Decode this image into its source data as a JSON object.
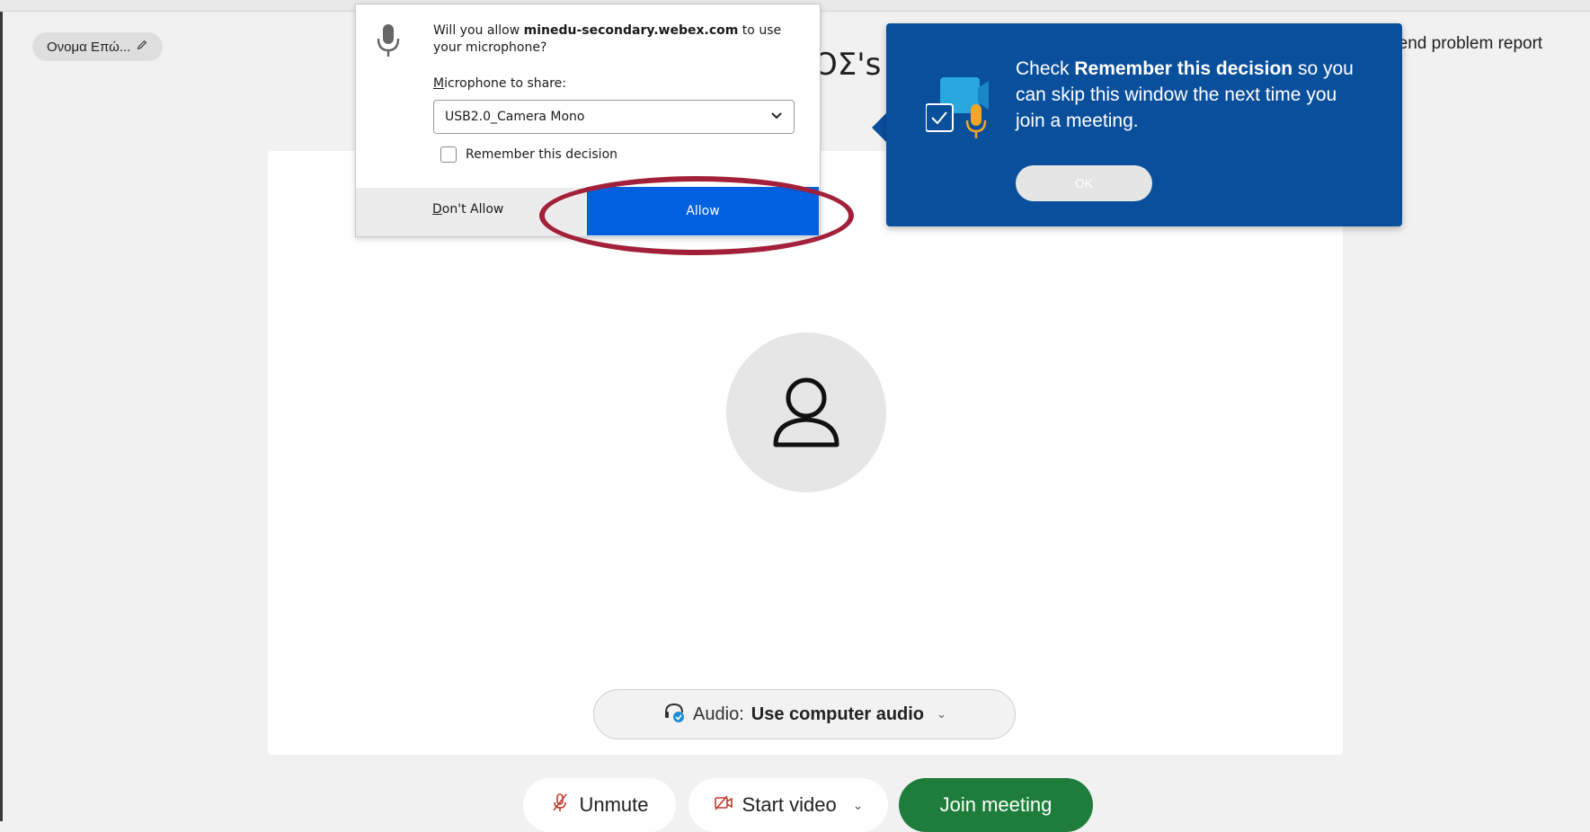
{
  "header": {
    "name_pill": "Ονομα Επώ...",
    "meeting_title_fragment": "ΟΣ's",
    "problem_report": "Send problem report"
  },
  "audio": {
    "prefix": "Audio:",
    "value": "Use computer audio"
  },
  "controls": {
    "unmute": "Unmute",
    "start_video": "Start video",
    "join": "Join meeting"
  },
  "permission_popup": {
    "question_prefix": "Will you allow ",
    "site": "minedu-secondary.webex.com",
    "question_suffix": " to use your microphone?",
    "label_first": "M",
    "label_rest": "icrophone to share:",
    "selected_device": "USB2.0_Camera Mono",
    "remember": "Remember this decision",
    "dont_allow": "Don't Allow",
    "allow": "Allow"
  },
  "tooltip": {
    "pre": "Check ",
    "bold": "Remember this decision",
    "post": " so you can skip this window the next time you join a meeting.",
    "ok": "OK"
  },
  "colors": {
    "tooltip_bg": "#0a4f9c",
    "allow_bg": "#0060df",
    "join_bg": "#1e7d3a",
    "highlight": "#a3203a"
  }
}
